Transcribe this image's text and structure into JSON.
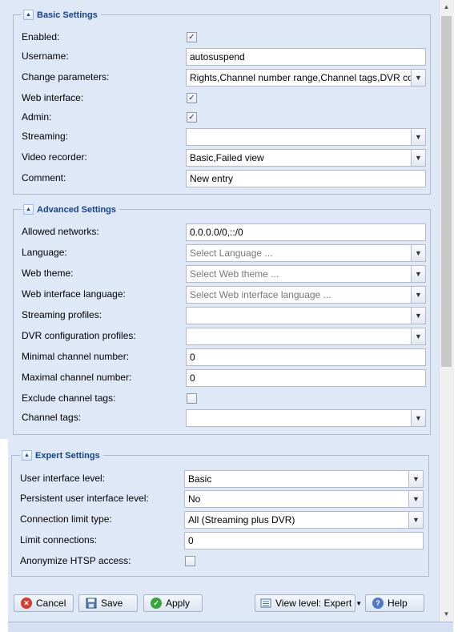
{
  "basic": {
    "legend": "Basic Settings",
    "enabled_label": "Enabled:",
    "enabled_checked": true,
    "username_label": "Username:",
    "username_value": "autosuspend",
    "change_params_label": "Change parameters:",
    "change_params_value": "Rights,Channel number range,Channel tags,DVR co",
    "web_interface_label": "Web interface:",
    "web_interface_checked": true,
    "admin_label": "Admin:",
    "admin_checked": true,
    "streaming_label": "Streaming:",
    "streaming_value": "",
    "video_recorder_label": "Video recorder:",
    "video_recorder_value": "Basic,Failed view",
    "comment_label": "Comment:",
    "comment_value": "New entry"
  },
  "advanced": {
    "legend": "Advanced Settings",
    "allowed_networks_label": "Allowed networks:",
    "allowed_networks_value": "0.0.0.0/0,::/0",
    "language_label": "Language:",
    "language_placeholder": "Select Language ...",
    "web_theme_label": "Web theme:",
    "web_theme_placeholder": "Select Web theme ...",
    "web_ui_language_label": "Web interface language:",
    "web_ui_language_placeholder": "Select Web interface language ...",
    "streaming_profiles_label": "Streaming profiles:",
    "streaming_profiles_value": "",
    "dvr_profiles_label": "DVR configuration profiles:",
    "dvr_profiles_value": "",
    "min_channel_label": "Minimal channel number:",
    "min_channel_value": "0",
    "max_channel_label": "Maximal channel number:",
    "max_channel_value": "0",
    "exclude_tags_label": "Exclude channel tags:",
    "exclude_tags_checked": false,
    "channel_tags_label": "Channel tags:",
    "channel_tags_value": ""
  },
  "expert": {
    "legend": "Expert Settings",
    "ui_level_label": "User interface level:",
    "ui_level_value": "Basic",
    "persistent_ui_label": "Persistent user interface level:",
    "persistent_ui_value": "No",
    "conn_limit_type_label": "Connection limit type:",
    "conn_limit_type_value": "All (Streaming plus DVR)",
    "limit_connections_label": "Limit connections:",
    "limit_connections_value": "0",
    "anonymize_label": "Anonymize HTSP access:",
    "anonymize_checked": false
  },
  "buttons": {
    "cancel": "Cancel",
    "save": "Save",
    "apply": "Apply",
    "view_level": "View level: Expert",
    "help": "Help"
  },
  "icons": {
    "collapse": "collapse-arrow-icon",
    "dropdown": "chevron-down-icon",
    "check": "checkmark-icon",
    "cancel": "cancel-icon",
    "save": "save-icon",
    "apply": "apply-icon",
    "view": "view-level-icon",
    "help": "help-icon"
  },
  "colors": {
    "panel_bg": "#dfe8f6",
    "legend_text": "#15428b",
    "field_border": "#b5b8c8"
  }
}
